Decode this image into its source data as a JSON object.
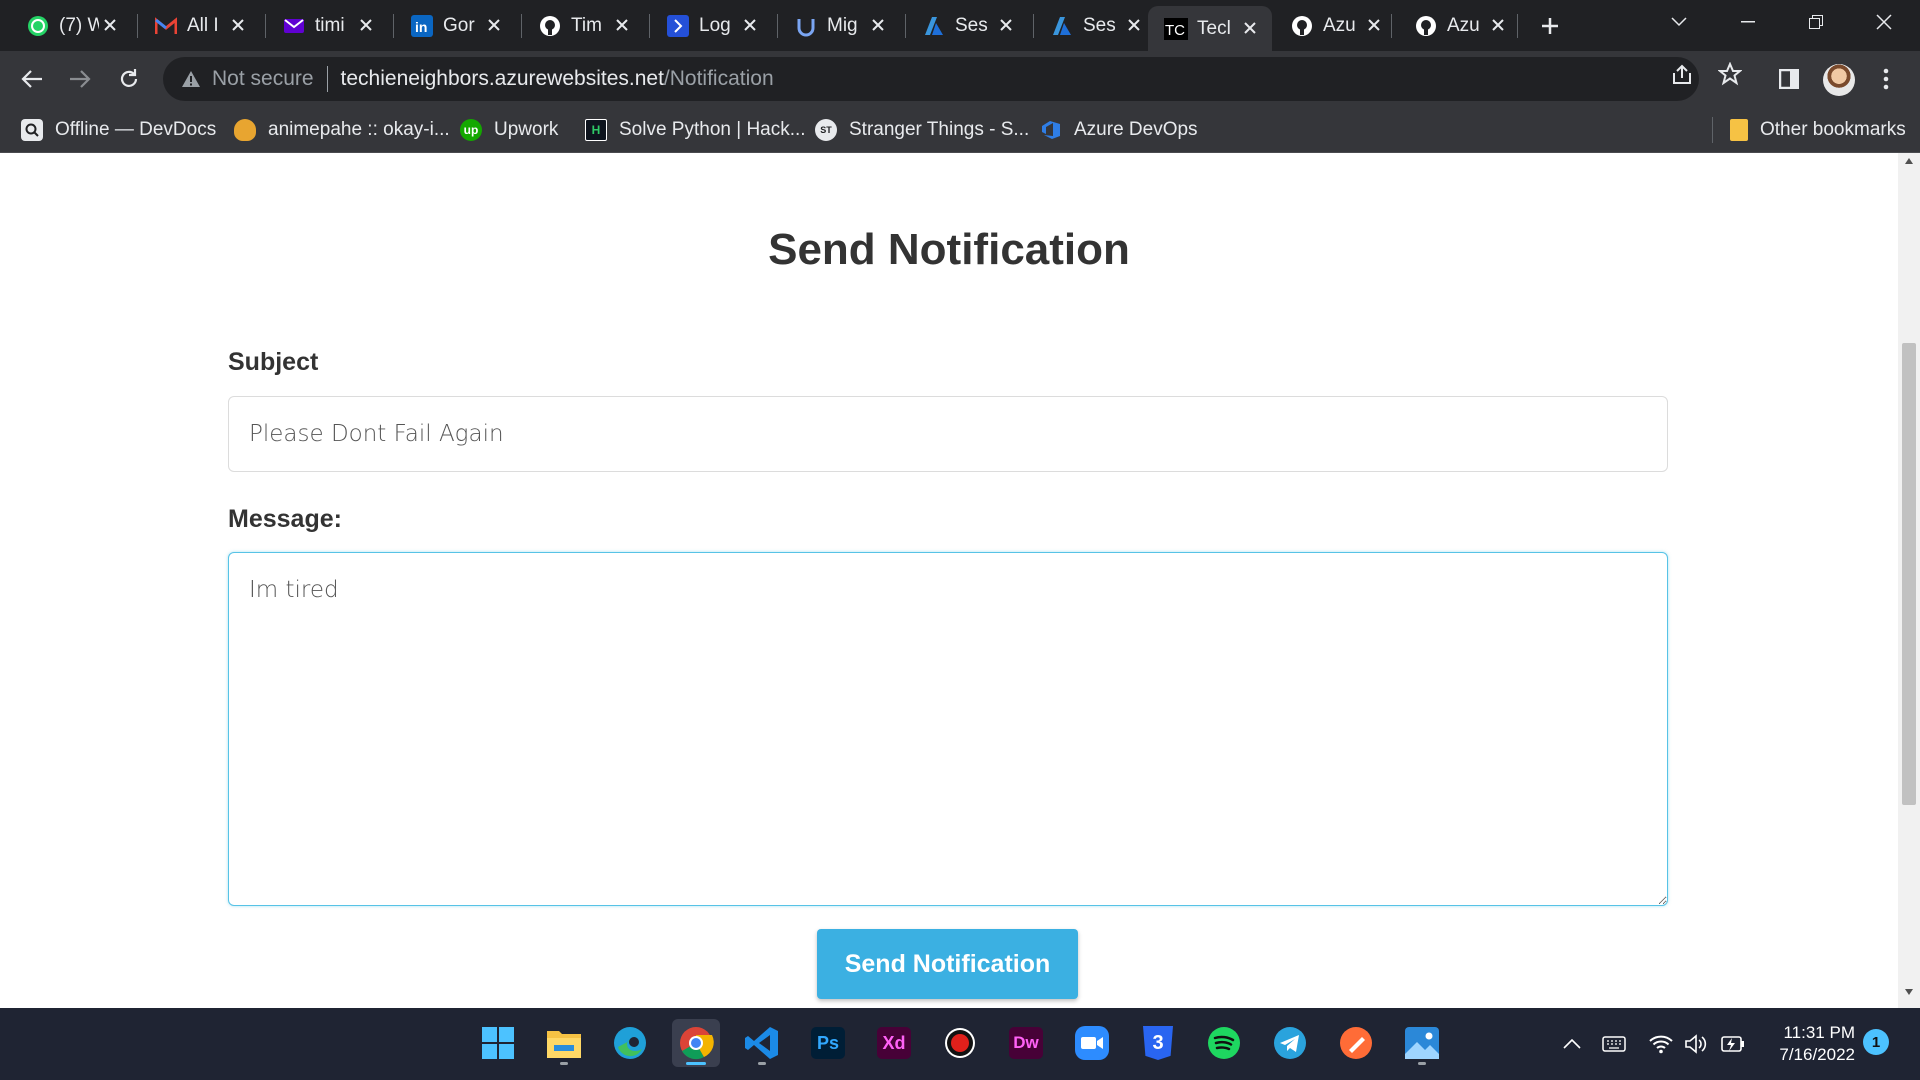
{
  "browser": {
    "tabs": [
      {
        "title": "(7) W",
        "icon": "whatsapp-icon"
      },
      {
        "title": "All I",
        "icon": "gmail-icon"
      },
      {
        "title": "timi",
        "icon": "yahoo-mail-icon"
      },
      {
        "title": "Gor",
        "icon": "linkedin-icon"
      },
      {
        "title": "Tim",
        "icon": "github-icon"
      },
      {
        "title": "Log",
        "icon": "azure-boards-icon"
      },
      {
        "title": "Mig",
        "icon": "udemy-icon"
      },
      {
        "title": "Ses",
        "icon": "azure-icon"
      },
      {
        "title": "Ses",
        "icon": "azure-icon"
      },
      {
        "title": "Tecl",
        "icon": "tc-icon",
        "active": true
      },
      {
        "title": "Azu",
        "icon": "github-icon"
      },
      {
        "title": "Azu",
        "icon": "github-icon"
      }
    ],
    "address": {
      "security_label": "Not secure",
      "host": "techieneighbors.azurewebsites.net",
      "path": "/Notification"
    },
    "bookmarks": [
      {
        "label": "Offline — DevDocs",
        "icon": "devdocs-icon"
      },
      {
        "label": "animepahe :: okay-i...",
        "icon": "animepahe-icon"
      },
      {
        "label": "Upwork",
        "icon": "upwork-icon"
      },
      {
        "label": "Solve Python | Hack...",
        "icon": "hackerrank-icon"
      },
      {
        "label": "Stranger Things - S...",
        "icon": "stranger-things-icon"
      },
      {
        "label": "Azure DevOps",
        "icon": "azure-devops-icon"
      }
    ],
    "other_bookmarks_label": "Other bookmarks"
  },
  "page": {
    "title": "Send Notification",
    "subject_label": "Subject",
    "subject_value": "Please Dont Fail Again",
    "message_label": "Message:",
    "message_value": "Im tired",
    "submit_label": "Send Notification"
  },
  "taskbar": {
    "apps": [
      {
        "name": "windows-start-icon"
      },
      {
        "name": "file-explorer-icon"
      },
      {
        "name": "edge-icon"
      },
      {
        "name": "chrome-icon",
        "active": true
      },
      {
        "name": "vscode-icon"
      },
      {
        "name": "photoshop-icon",
        "text": "Ps"
      },
      {
        "name": "adobe-xd-icon",
        "text": "Xd"
      },
      {
        "name": "recorder-icon"
      },
      {
        "name": "dreamweaver-icon",
        "text": "Dw"
      },
      {
        "name": "zoom-icon"
      },
      {
        "name": "css3-icon",
        "text": "3"
      },
      {
        "name": "spotify-icon"
      },
      {
        "name": "telegram-icon"
      },
      {
        "name": "postman-icon"
      },
      {
        "name": "photos-icon"
      }
    ],
    "time": "11:31 PM",
    "date": "7/16/2022",
    "notification_count": "1"
  },
  "colors": {
    "accent": "#3bb0e2",
    "input_focus": "#57c3e6",
    "heading": "#333333"
  }
}
